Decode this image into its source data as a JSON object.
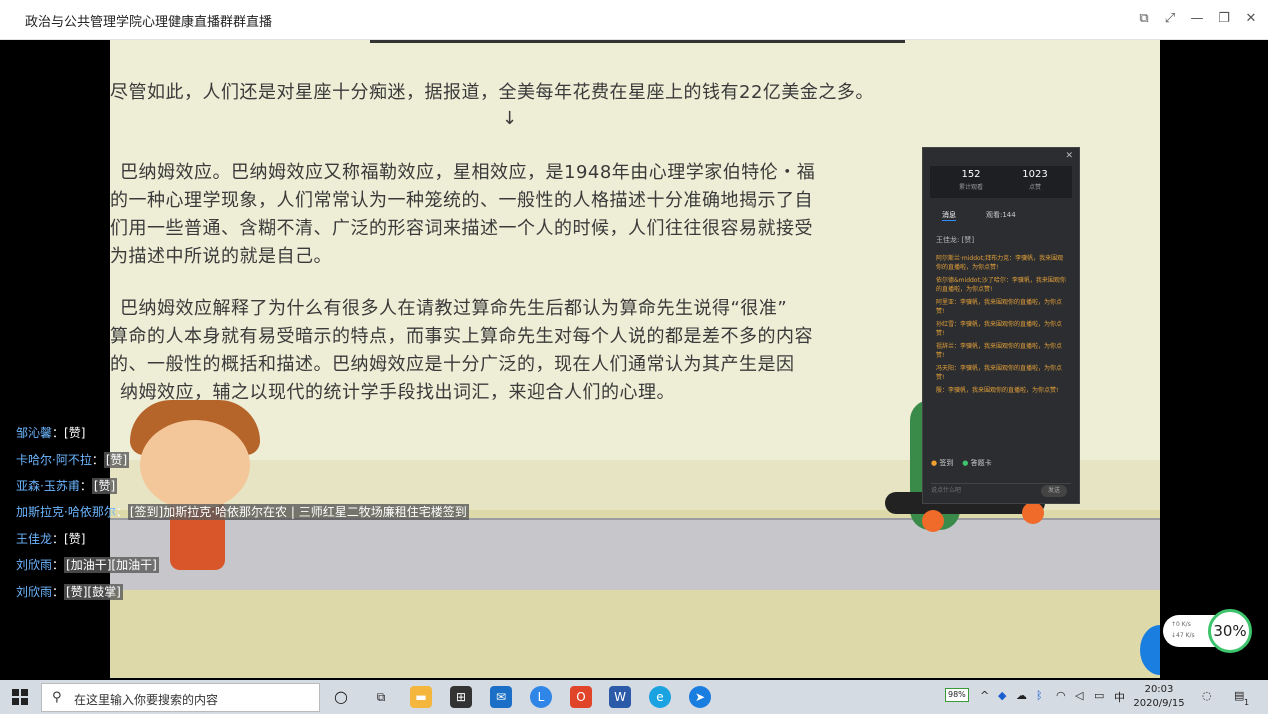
{
  "window": {
    "title": "政治与公共管理学院心理健康直播群群直播",
    "btn_popout": "⧉",
    "btn_fullscreen": "⤢",
    "btn_minimize": "—",
    "btn_maximize": "❐",
    "btn_close": "✕"
  },
  "slide": {
    "lines": [
      "尽管如此，人们还是对星座十分痴迷，据报道，全美每年花费在星座上的钱有22亿美金之多。",
      "↓",
      "巴纳姆效应。巴纳姆效应又称福勒效应，星相效应，是1948年由心理学家伯特伦・福",
      "的一种心理学现象，人们常常认为一种笼统的、一般性的人格描述十分准确地揭示了自",
      "们用一些普通、含糊不清、广泛的形容词来描述一个人的时候，人们往往很容易就接受",
      "为描述中所说的就是自己。",
      "巴纳姆效应解释了为什么有很多人在请教过算命先生后都认为算命先生说得“很准”",
      "算命的人本身就有易受暗示的特点，而事实上算命先生对每个人说的都是差不多的内容",
      "的、一般性的概括和描述。巴纳姆效应是十分广泛的，现在人们通常认为其产生是因",
      "纳姆效应，辅之以现代的统计学手段找出词汇，来迎合人们的心理。"
    ]
  },
  "overlay": {
    "close": "✕",
    "stats": [
      {
        "num": "152",
        "label": "累计观看"
      },
      {
        "num": "1023",
        "label": "点赞"
      }
    ],
    "tabs": [
      {
        "label": "消息"
      },
      {
        "label": "观看:144"
      }
    ],
    "sys_msg": "王佳龙: [赞]",
    "messages": [
      "阿尔斯兰·middot;拜布力克：李骥帆，我来围观你的直播啦，为你点赞!",
      "依尔德&middot;沙了哈尔：李骥帆，我来围观你的直播啦，为你点赞!",
      "阿里亚：李骥帆，我来围观你的直播啦，为你点赞!",
      "孙红雪：李骥帆，我来围观你的直播啦，为你点赞!",
      "祖辞兰：李骥帆，我来围观你的直播啦，为你点赞!",
      "冯天阳：李骥帆，我来围观你的直播啦，为你点赞!",
      "殷：李骥帆，我来围观你的直播啦，为你点赞!"
    ],
    "checkin": "签到",
    "card": "答题卡",
    "input_placeholder": "说点什么吧",
    "send": "发送"
  },
  "danmu": [
    {
      "name": "邹沁馨",
      "sep": "：",
      "msg": "[赞]",
      "bg": false
    },
    {
      "name": "卡哈尔·阿不拉",
      "sep": "：",
      "msg": "[赞]",
      "bg": true
    },
    {
      "name": "亚森·玉苏甫",
      "sep": "：",
      "msg": "[赞]",
      "bg": true
    },
    {
      "name": "加斯拉克·哈依那尔",
      "sep": "：",
      "msg": "[签到]加斯拉克·哈依那尔在农 | 三师红星二牧场廉租住宅楼签到",
      "bg": true
    },
    {
      "name": "王佳龙",
      "sep": "：",
      "msg": "[赞]",
      "bg": false
    },
    {
      "name": "刘欣雨",
      "sep": "：",
      "msg": "[加油干][加油干]",
      "bg": true
    },
    {
      "name": "刘欣雨",
      "sep": "：",
      "msg": "[赞][鼓掌]",
      "bg": true
    }
  ],
  "netmon": {
    "up": "↑0  K/s",
    "down": "↓47  K/s",
    "percent": "30%"
  },
  "taskbar": {
    "search_placeholder": "在这里输入你要搜索的内容",
    "battery": "98%",
    "ime": "中",
    "time": "20:03",
    "date": "2020/9/15",
    "notif_count": "1"
  }
}
